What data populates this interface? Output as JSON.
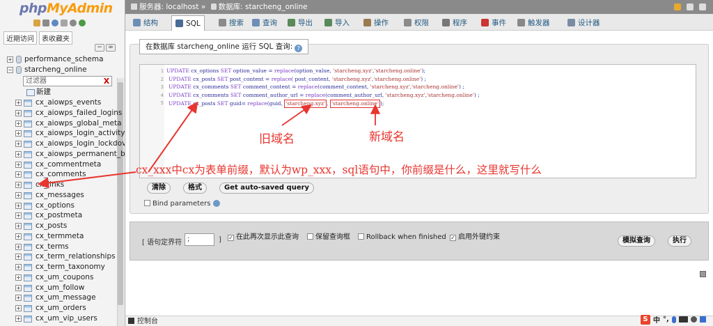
{
  "logo": {
    "php": "php",
    "myadmin": "MyAdmin"
  },
  "sidebar": {
    "tab_recent": "近期访问",
    "tab_favorites": "表收藏夹",
    "filter_placeholder": "过滤器",
    "filter_clear": "X",
    "databases": [
      {
        "name": "performance_schema",
        "expander": "+"
      },
      {
        "name": "starcheng_online",
        "expander": "−"
      }
    ],
    "new_label": "新建",
    "tables": [
      "cx_aiowps_events",
      "cx_aiowps_failed_logins",
      "cx_aiowps_global_meta",
      "cx_aiowps_login_activity",
      "cx_aiowps_login_lockdov",
      "cx_aiowps_permanent_bl",
      "cx_commentmeta",
      "cx_comments",
      "cx_links",
      "cx_messages",
      "cx_options",
      "cx_postmeta",
      "cx_posts",
      "cx_termmeta",
      "cx_terms",
      "cx_term_relationships",
      "cx_term_taxonomy",
      "cx_um_coupons",
      "cx_um_follow",
      "cx_um_message",
      "cx_um_orders",
      "cx_um_vip_users"
    ]
  },
  "breadcrumb": {
    "server": "服务器: localhost »",
    "database": "数据库: starcheng_online"
  },
  "tabs": [
    {
      "label": "结构",
      "icon": "structure-icon"
    },
    {
      "label": "SQL",
      "icon": "sql-icon",
      "active": true
    },
    {
      "label": "搜索",
      "icon": "search-icon"
    },
    {
      "label": "查询",
      "icon": "query-icon"
    },
    {
      "label": "导出",
      "icon": "export-icon"
    },
    {
      "label": "导入",
      "icon": "import-icon"
    },
    {
      "label": "操作",
      "icon": "wrench-icon"
    },
    {
      "label": "权限",
      "icon": "privileges-icon"
    },
    {
      "label": "程序",
      "icon": "routines-icon"
    },
    {
      "label": "事件",
      "icon": "clock-icon"
    },
    {
      "label": "触发器",
      "icon": "triggers-icon"
    },
    {
      "label": "设计器",
      "icon": "designer-icon"
    }
  ],
  "query_panel": {
    "legend": "在数据库 starcheng_online 运行 SQL 查询:",
    "line_numbers": [
      "1",
      "2",
      "3",
      "4",
      "5"
    ],
    "sql_lines": [
      {
        "kw1": "UPDATE",
        "t1": " cx_options ",
        "kw2": "SET",
        "t2": " option_value = ",
        "kw3": "replace",
        "t3": "(option_value, ",
        "s1": "'starcheng.xyz'",
        "t4": ",",
        "s2": "'starcheng.online'",
        "t5": ");"
      },
      {
        "kw1": "UPDATE",
        "t1": " cx_posts ",
        "kw2": "SET",
        "t2": " post_content = ",
        "kw3": "replace",
        "t3": "( post_content, ",
        "s1": "'starcheng.xyz'",
        "t4": ",",
        "s2": "'starcheng.online'",
        "t5": ") ;"
      },
      {
        "kw1": "UPDATE",
        "t1": " cx_comments ",
        "kw2": "SET",
        "t2": " comment_content = ",
        "kw3": "replace",
        "t3": "(comment_content, ",
        "s1": "'starcheng.xyz'",
        "t4": ",",
        "s2": "'starcheng.online'",
        "t5": ") ;"
      },
      {
        "kw1": "UPDATE",
        "t1": " cx_comments ",
        "kw2": "SET",
        "t2": " comment_author_url = ",
        "kw3": "replace",
        "t3": "(comment_author_url, ",
        "s1": "'starcheng.xyz'",
        "t4": ",",
        "s2": "'starcheng.online'",
        "t5": ") ;"
      },
      {
        "kw1": "UPDATE",
        "t1": " cx_posts ",
        "kw2": "SET",
        "t2": " guid= ",
        "kw3": "replace",
        "t3": "(guid, ",
        "s1": "'starcheng.xyz'",
        "t4": ", ",
        "s2": "'starcheng.online'",
        "t5": ");"
      }
    ],
    "btn_clear": "清除",
    "btn_format": "格式",
    "btn_autosaved": "Get auto-saved query",
    "bind_params": "Bind parameters"
  },
  "options": {
    "delimiter_label": "[ 语句定界符",
    "delimiter_value": ";",
    "delimiter_close": "]",
    "show_again": "在此再次显示此查询",
    "show_again_checked": "✓",
    "keep_box": "保留查询框",
    "rollback": "Rollback when finished",
    "foreign_keys": "启用外键约束",
    "foreign_keys_checked": "✓",
    "btn_simulate": "模拟查询",
    "btn_go": "执行"
  },
  "console": {
    "label": "控制台"
  },
  "ime": {
    "logo": "S",
    "lang": "中",
    "punct": "°,"
  },
  "annotations": {
    "old_domain": "旧域名",
    "new_domain": "新域名",
    "prefix_note": "cx_xxx中cx为表单前缀，默认为wp_xxx，sql语句中，你前缀是什么，这里就写什么",
    "color": "#e8352f"
  }
}
